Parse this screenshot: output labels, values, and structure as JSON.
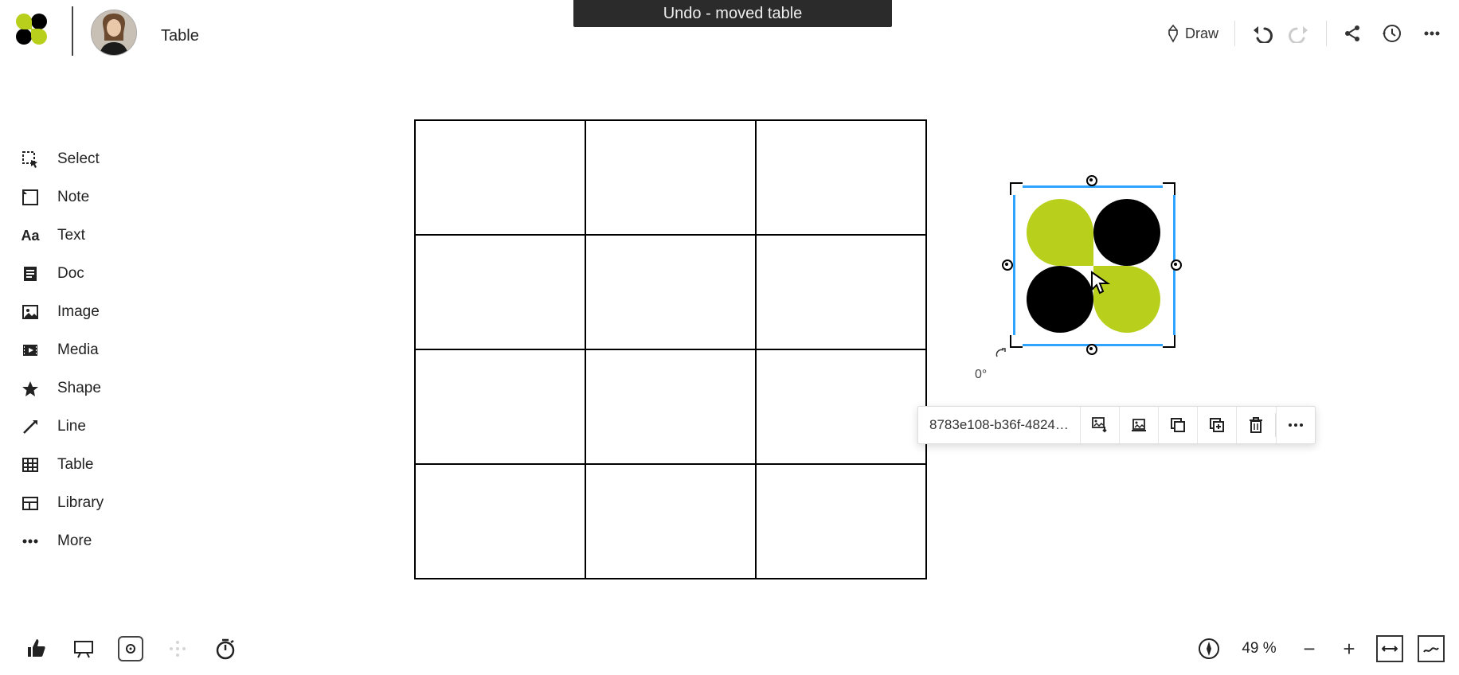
{
  "header": {
    "title": "Table"
  },
  "toast": {
    "text": "Undo - moved table"
  },
  "topbar": {
    "draw_label": "Draw"
  },
  "sidebar": {
    "items": [
      {
        "label": "Select"
      },
      {
        "label": "Note"
      },
      {
        "label": "Text"
      },
      {
        "label": "Doc"
      },
      {
        "label": "Image"
      },
      {
        "label": "Media"
      },
      {
        "label": "Shape"
      },
      {
        "label": "Line"
      },
      {
        "label": "Table"
      },
      {
        "label": "Library"
      },
      {
        "label": "More"
      }
    ]
  },
  "selection": {
    "rotation_label": "0°",
    "context_label": "8783e108-b36f-4824…"
  },
  "zoom": {
    "percent": "49 %"
  }
}
